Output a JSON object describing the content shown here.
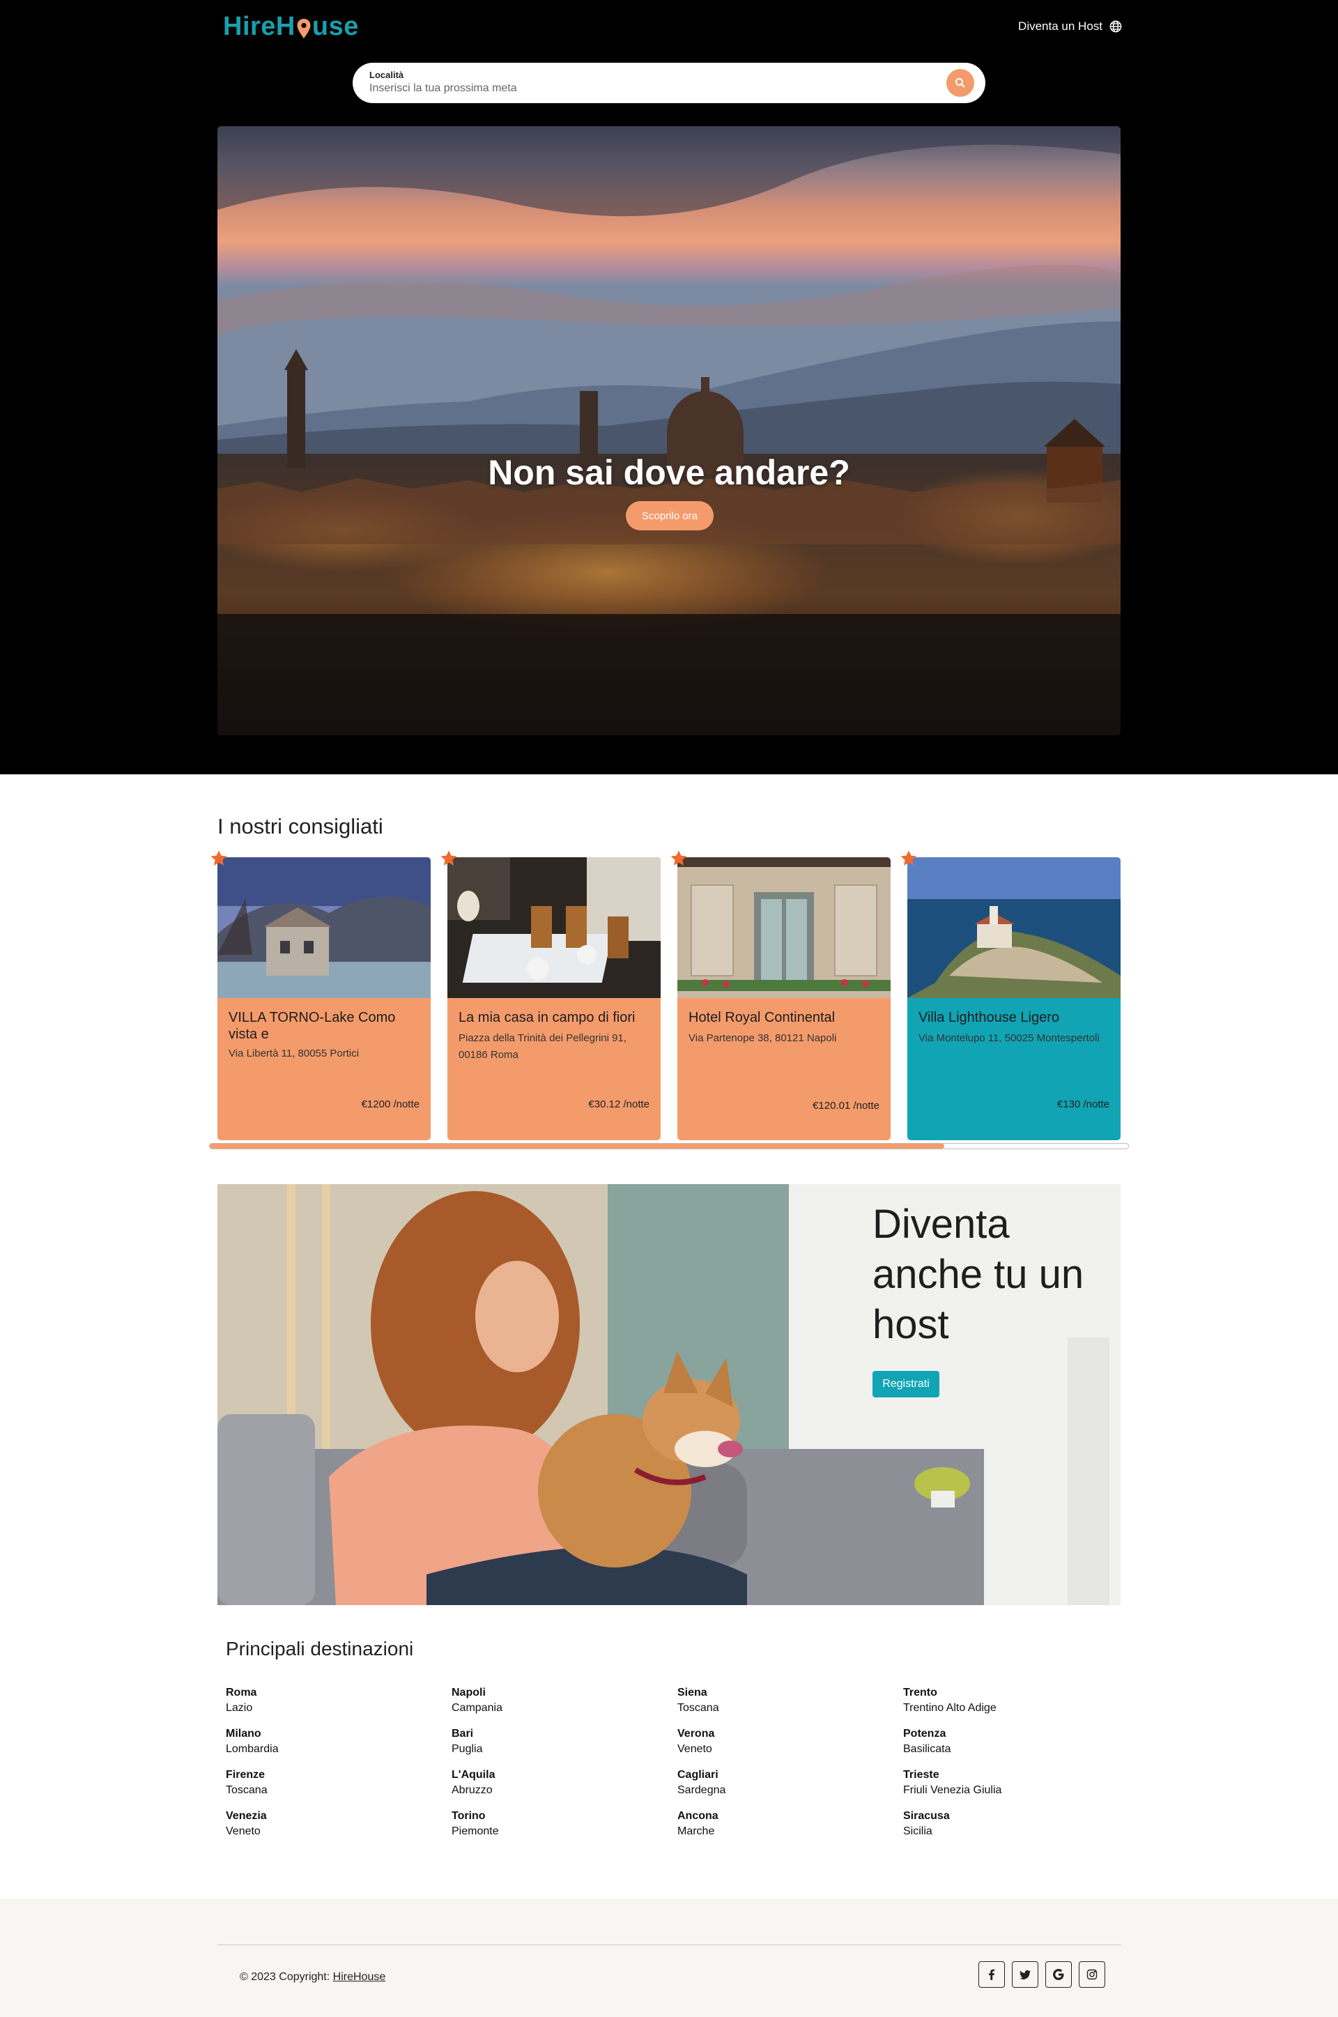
{
  "colors": {
    "accent": "#f49b6c",
    "brand": "#1a9fac",
    "teal": "#11a4b4",
    "header_bg": "#000000",
    "footer_bg": "#f7f6f2"
  },
  "header": {
    "logo": {
      "part1": "Hire",
      "part2": "use"
    },
    "host_link": "Diventa un Host",
    "host_link_icon": "globe-icon"
  },
  "search": {
    "label": "Località",
    "placeholder": "Inserisci la tua prossima meta",
    "button_icon": "search-icon"
  },
  "hero": {
    "title": "Non sai dove andare?",
    "cta": "Scoprilo ora"
  },
  "recommended": {
    "title": "I nostri consigliati",
    "scroll_progress": 0.8,
    "cards": [
      {
        "name": "VILLA TORNO-Lake Como vista e",
        "address": "Via Libertà 11, 80055 Portici",
        "price": "€1200 /notte"
      },
      {
        "name": "La mia casa in campo di fiori",
        "address": "Piazza della Trinità dei Pellegrini 91, 00186 Roma",
        "price": "€30.12 /notte"
      },
      {
        "name": "Hotel Royal Continental",
        "address": "Via Partenope 38, 80121 Napoli",
        "price": "€120.01 /notte"
      },
      {
        "name": "Villa Lighthouse Ligero",
        "address": "Via Montelupo 11, 50025 Montespertoli",
        "price": "€130 /notte"
      }
    ]
  },
  "host_banner": {
    "title": "Diventa anche tu un host",
    "button": "Registrati"
  },
  "destinations": {
    "title": "Principali destinazioni",
    "items": [
      {
        "city": "Roma",
        "region": "Lazio"
      },
      {
        "city": "Napoli",
        "region": "Campania"
      },
      {
        "city": "Siena",
        "region": "Toscana"
      },
      {
        "city": "Trento",
        "region": "Trentino Alto Adige"
      },
      {
        "city": "Milano",
        "region": "Lombardia"
      },
      {
        "city": "Bari",
        "region": "Puglia"
      },
      {
        "city": "Verona",
        "region": "Veneto"
      },
      {
        "city": "Potenza",
        "region": "Basilicata"
      },
      {
        "city": "Firenze",
        "region": "Toscana"
      },
      {
        "city": "L'Aquila",
        "region": "Abruzzo"
      },
      {
        "city": "Cagliari",
        "region": "Sardegna"
      },
      {
        "city": "Trieste",
        "region": "Friuli Venezia Giulia"
      },
      {
        "city": "Venezia",
        "region": "Veneto"
      },
      {
        "city": "Torino",
        "region": "Piemonte"
      },
      {
        "city": "Ancona",
        "region": "Marche"
      },
      {
        "city": "Siracusa",
        "region": "Sicilia"
      }
    ]
  },
  "footer": {
    "copyright": "© 2023 Copyright:",
    "brand_link": "HireHouse",
    "socials": [
      "facebook-icon",
      "twitter-icon",
      "google-icon",
      "instagram-icon"
    ]
  }
}
